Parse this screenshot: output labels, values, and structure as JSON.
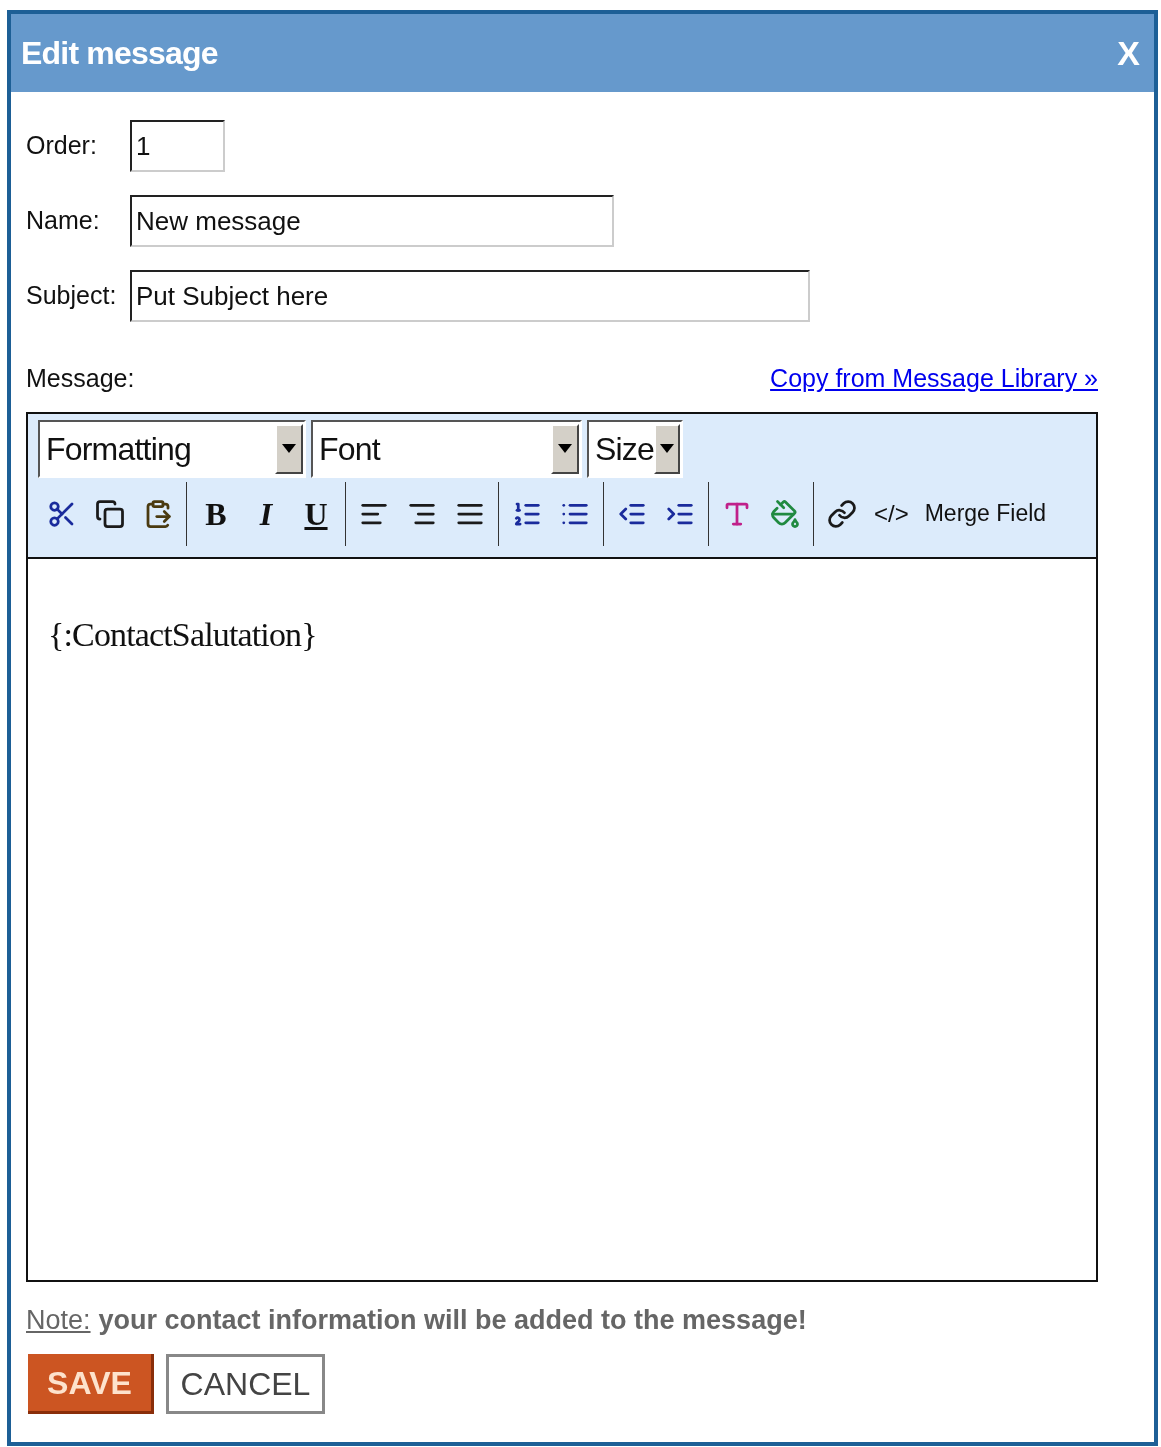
{
  "window": {
    "title": "Edit message",
    "close": "X"
  },
  "fields": [
    {
      "label": "Order:",
      "value": "1"
    },
    {
      "label": "Name:",
      "value": "New message"
    },
    {
      "label": "Subject:",
      "value": "Put Subject here"
    }
  ],
  "message": {
    "label": "Message:",
    "link": "Copy from Message Library »"
  },
  "toolbar": {
    "dropdowns": [
      "Formatting",
      "Font",
      "Size"
    ],
    "text_buttons": [
      "B",
      "I",
      "U"
    ],
    "code_button": "</>",
    "merge_button": "Merge Field"
  },
  "editor": {
    "content": "{:ContactSalutation}"
  },
  "note": {
    "label": "Note:",
    "text": "your contact information will be added to the message!"
  },
  "buttons": {
    "save": "SAVE",
    "cancel": "CANCEL"
  }
}
